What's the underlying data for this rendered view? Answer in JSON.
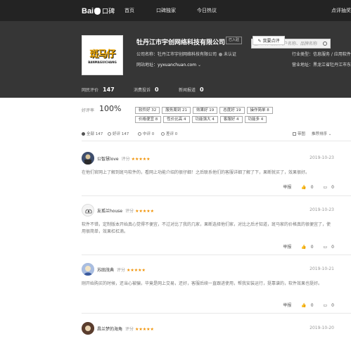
{
  "nav": {
    "logo_text": "Bai",
    "logo_suffix": "口碑",
    "items": [
      "首页",
      "口碑独家",
      "今日热议"
    ],
    "right": "点评抽奖"
  },
  "search": {
    "placeholder": "查口碑，搜索商户名称、品牌名称"
  },
  "company": {
    "logo_text": "斑马仔",
    "logo_sub": "BANMAGUICHANG",
    "name": "牡丹江市宇创网络科技有限公司",
    "claim_label": "已入驻",
    "my_review_button": "我要点评",
    "full_name_label": "公司名称：牡丹江市宇创网络科技有限公司",
    "verify_status": "未认证",
    "website_label": "网站地址：",
    "website": "yyxuanchuan.com",
    "industry_label": "行业类型：信息服务 / 应用软件",
    "address_label": "营业地址：黑龙江省牡丹江市东安区"
  },
  "stats": {
    "reviews_label": "网民评价",
    "reviews_count": "147",
    "complaints_label": "消费投诉",
    "complaints_count": "0",
    "news_label": "新闻报道",
    "news_count": "0"
  },
  "summary": {
    "good_rate_label": "好评率",
    "good_rate": "100%",
    "tags": [
      "软件好 32",
      "服务周到 21",
      "效果好 19",
      "态度好 19",
      "操作简单 8",
      "价格便宜 8",
      "性价比高 4",
      "功能强大 4",
      "客服好 4",
      "功能多 4"
    ]
  },
  "filter": {
    "all": "全部 147",
    "good": "好评 147",
    "mid": "中评 0",
    "bad": "差评 0",
    "with_pic": "带图",
    "sort": "推荐排序"
  },
  "reviews": [
    {
      "user": "公智慧love",
      "score_label": "评分",
      "stars": "★★★★★",
      "date": "2019-10-23",
      "text": "在他们官网上了解到斑马软件的，看网上功能介绍的很仔细！之后联系他们的客服详细了解了下，果断就买了，效果很好。",
      "report": "举报",
      "likes": "0",
      "comments": "0"
    },
    {
      "user": "友孤兰house",
      "score_label": "评分",
      "stars": "★★★★★",
      "date": "2019-10-23",
      "text": "软件不错，定制版本开始真心觉得不便宜，不过对比了我的几家，果断选择他们家，对比之后才知道，斑马家的价格真的很便宜了，使用很简单，效果杠杠滴。",
      "report": "举报",
      "likes": "0",
      "comments": "0"
    },
    {
      "user": "苏田茂典",
      "score_label": "评分",
      "stars": "★★★★★",
      "date": "2019-10-21",
      "text": "刚开始购买的时候，还当心被骗，毕竟是网上交易，还好，客服后续一直跟进使用，帮我安装运行，挺靠谱的，软件效果也挺好。",
      "report": "举报",
      "likes": "0",
      "comments": "0"
    },
    {
      "user": "昌兰梦的海角",
      "score_label": "评分",
      "stars": "★★★★★",
      "date": "2019-10-20",
      "text": "",
      "report": "",
      "likes": "",
      "comments": ""
    }
  ]
}
